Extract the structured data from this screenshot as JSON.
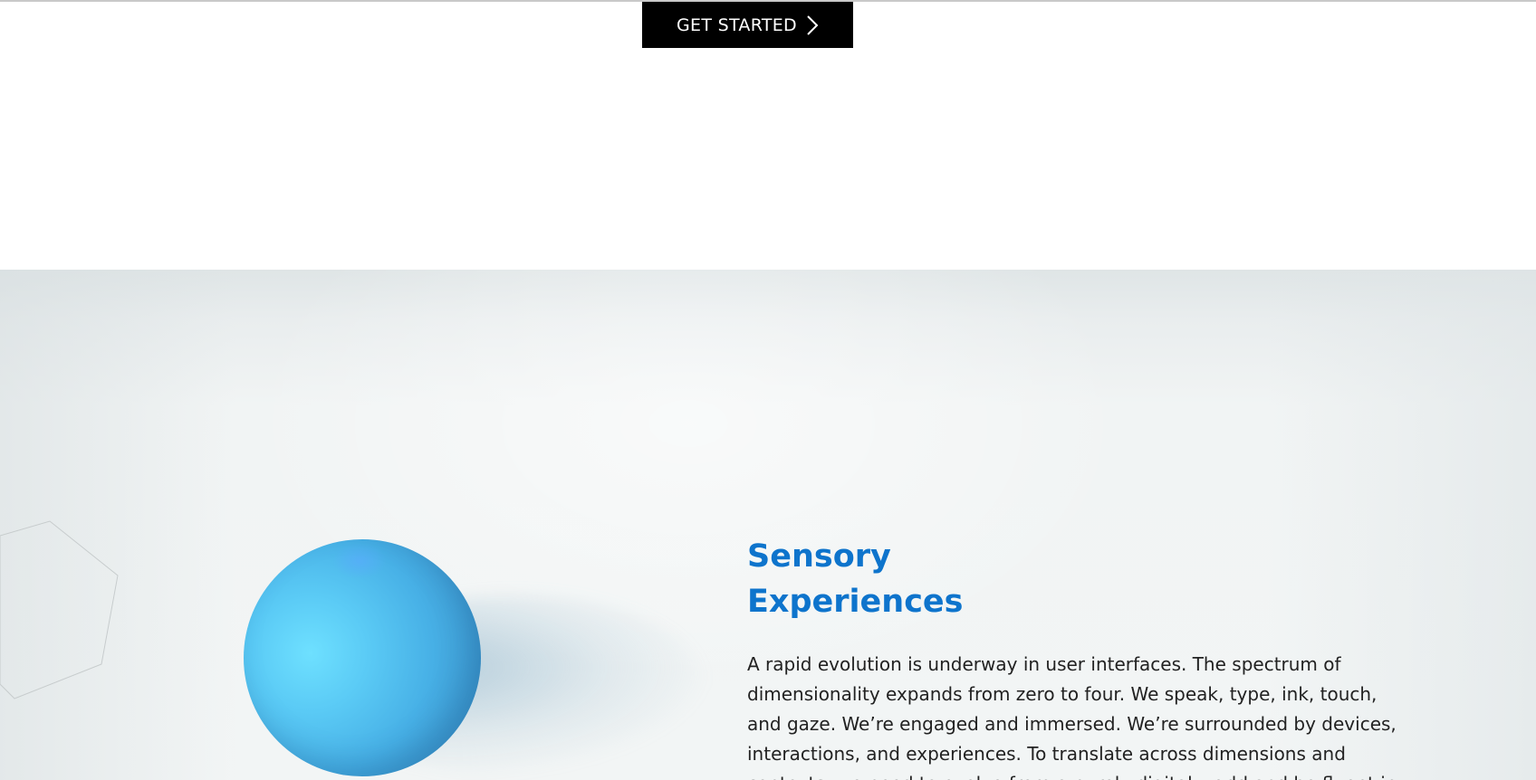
{
  "header": {
    "cta_label": "GET STARTED",
    "cta_icon": "chevron-right-icon"
  },
  "hero": {
    "title_line_1": "Sensory",
    "title_line_2": "Experiences",
    "body": "A rapid evolution is underway in user interfaces. The spectrum of dimensionality expands from zero to four. We speak, type, ink, touch, and gaze. We’re engaged and immersed. We’re surrounded by devices, interactions, and experiences. To translate across dimensions and contexts, we need to evolve from a purely digital world and be fluent in",
    "title_color": "#0e74cc",
    "illustration": "blue-sphere",
    "decoration": "hexagon-outline"
  }
}
